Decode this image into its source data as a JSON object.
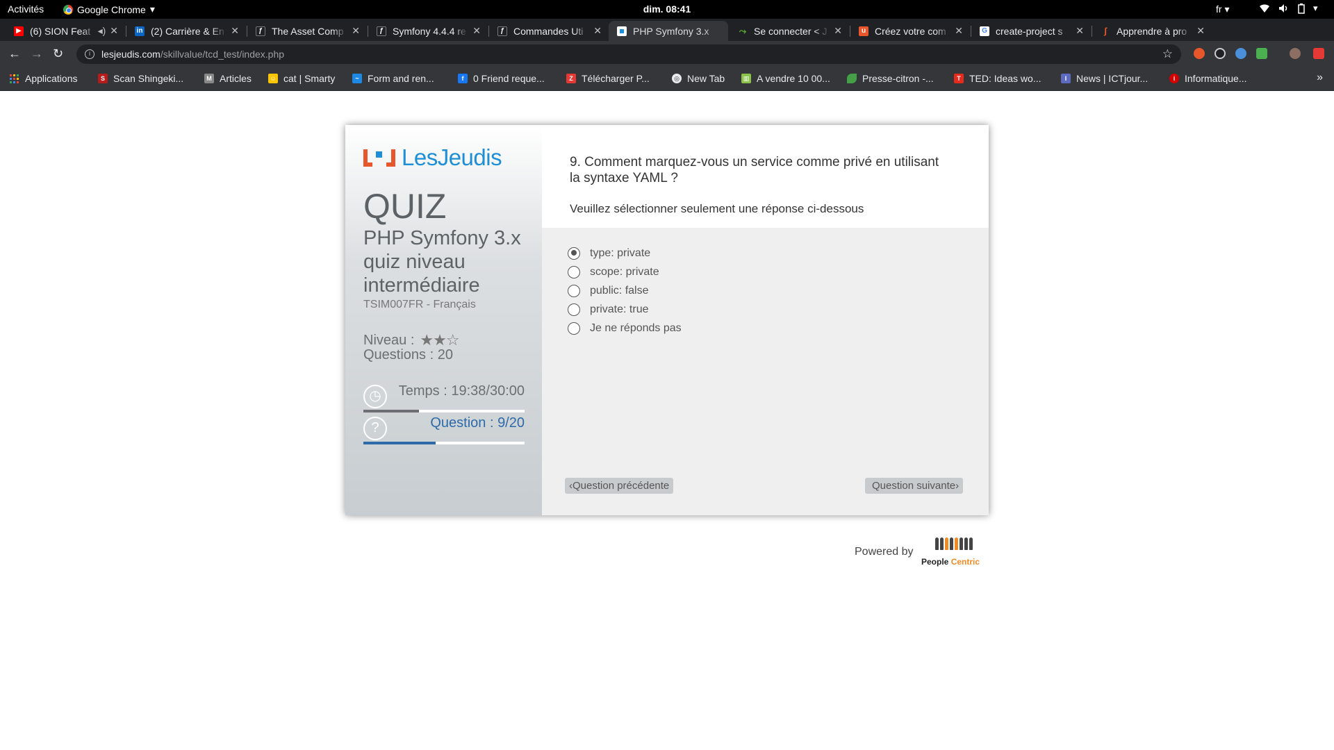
{
  "topbar": {
    "activities": "Activités",
    "app_name": "Google Chrome",
    "clock": "dim. 08:41",
    "lang": "fr"
  },
  "tabs": [
    {
      "title": "(6) SION Feat",
      "icon_color": "#ff0000",
      "icon": "youtube-icon"
    },
    {
      "title": "(2) Carrière & En",
      "icon_color": "#0a66c2",
      "icon": "linkedin-icon"
    },
    {
      "title": "The Asset Comp",
      "icon_color": "#202124",
      "icon": "symfony-icon"
    },
    {
      "title": "Symfony 4.4.4 re",
      "icon_color": "#202124",
      "icon": "symfony-icon"
    },
    {
      "title": "Commandes Uti",
      "icon_color": "#202124",
      "icon": "symfony-icon"
    },
    {
      "title": "PHP Symfony 3.x",
      "icon_color": "#1e8fd6",
      "icon": "lesjeudis-icon",
      "active": true
    },
    {
      "title": "Se connecter < J",
      "icon_color": "#58b32d",
      "icon": "jobs-icon"
    },
    {
      "title": "Créez votre com",
      "icon_color": "#e8572b",
      "icon": "site-icon"
    },
    {
      "title": "create-project s",
      "icon_color": "#ffffff",
      "icon": "google-icon"
    },
    {
      "title": "Apprendre à pro",
      "icon_color": "#e8572b",
      "icon": "symfony-icon"
    }
  ],
  "address": {
    "host": "lesjeudis.com",
    "path": "/skillvalue/tcd_test/index.php"
  },
  "bookmarks": [
    {
      "label": "Applications",
      "icon": "apps-grid-icon",
      "color": "#4285f4"
    },
    {
      "label": "Scan Shingeki...",
      "icon": "manga-icon",
      "color": "#b71c1c"
    },
    {
      "label": "Articles",
      "icon": "articles-icon",
      "color": "#888888"
    },
    {
      "label": "cat | Smarty",
      "icon": "smarty-icon",
      "color": "#f9c400"
    },
    {
      "label": "Form and ren...",
      "icon": "form-icon",
      "color": "#1e88e5"
    },
    {
      "label": "0 Friend reque...",
      "icon": "facebook-icon",
      "color": "#1877f2"
    },
    {
      "label": "Télécharger P...",
      "icon": "download-icon",
      "color": "#e53935"
    },
    {
      "label": "New Tab",
      "icon": "newtab-icon",
      "color": "#e8eaed"
    },
    {
      "label": "A vendre 10 00...",
      "icon": "building-icon",
      "color": "#8bc34a"
    },
    {
      "label": "Presse-citron -...",
      "icon": "lemon-icon",
      "color": "#43a047"
    },
    {
      "label": "TED: Ideas wo...",
      "icon": "ted-icon",
      "color": "#e62b1e"
    },
    {
      "label": "News | ICTjour...",
      "icon": "ict-icon",
      "color": "#5c6bc0"
    },
    {
      "label": "Informatique...",
      "icon": "info-icon",
      "color": "#d50000"
    }
  ],
  "quiz": {
    "logo_text": "LesJeudis",
    "heading": "QUIZ",
    "subtitle": "PHP Symfony 3.x quiz niveau intermédiaire",
    "code": "TSIM007FR - Français",
    "level_label": "Niveau :",
    "level_stars": 2,
    "level_max": 3,
    "questions_label": "Questions : 20",
    "timer_label": "Temps : 19:38/30:00",
    "timer_progress": 0.345,
    "question_label": "Question : 9/20",
    "question_progress": 0.45
  },
  "question": {
    "title": "9. Comment marquez-vous un service comme privé en utilisant la syntaxe YAML ?",
    "hint": "Veuillez sélectionner seulement une réponse ci-dessous",
    "answers": [
      {
        "label": "type: private",
        "checked": true
      },
      {
        "label": "scope: private",
        "checked": false
      },
      {
        "label": "public: false",
        "checked": false
      },
      {
        "label": "private: true",
        "checked": false
      },
      {
        "label": "Je ne réponds pas",
        "checked": false
      }
    ],
    "prev_label": "Question précédente",
    "next_label": "Question suivante"
  },
  "footer": {
    "powered_by": "Powered by",
    "brand_a": "People ",
    "brand_b": "Centric"
  }
}
